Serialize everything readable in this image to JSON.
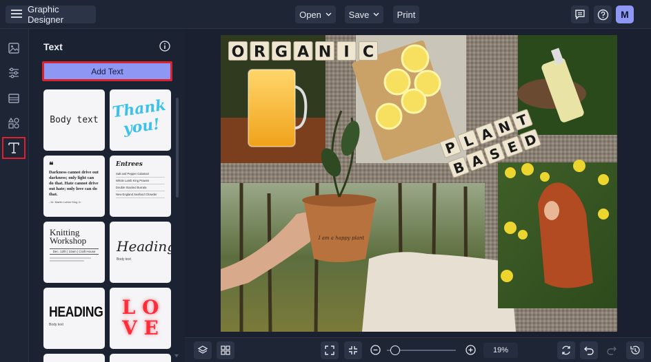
{
  "app": {
    "title": "Graphic Designer"
  },
  "toolbar": {
    "open_label": "Open",
    "save_label": "Save",
    "print_label": "Print",
    "avatar_initial": "M"
  },
  "panel": {
    "title": "Text",
    "add_text_label": "Add Text",
    "templates": {
      "body_text": "Body text",
      "thank_you_1": "Thank",
      "thank_you_2": "you!",
      "quote_text": "Darkness cannot drive out darkness; only light can do that. Hate cannot drive out hate; only love can do that.",
      "quote_author": "- Dr. Martin Luther King Jr.",
      "entrees_title": "Entrees",
      "entrees_items": [
        "Salt and Pepper Calamari",
        "Whole Lamb King Prawns",
        "Double Stacked Burrata",
        "New England Seafood Chowder"
      ],
      "knitting_title_1": "Knitting",
      "knitting_title_2": "Workshop",
      "knitting_details": "Dec. 12th | 10am | Craft House",
      "heading_script": "Heading",
      "heading_script_sub": "Body text",
      "heading_bold": "HEADING",
      "heading_bold_sub": "Body text",
      "love_1": "L O",
      "love_2": "V E"
    }
  },
  "canvas": {
    "organic_tiles": [
      "O",
      "R",
      "G",
      "A",
      "N",
      "I",
      "C"
    ],
    "plant_tiles": [
      "P",
      "L",
      "A",
      "N",
      "T"
    ],
    "based_tiles": [
      "B",
      "A",
      "S",
      "E",
      "D"
    ],
    "pot_text": "I am a happy plant"
  },
  "bottombar": {
    "zoom_value": "19%",
    "zoom_level": 0.06
  },
  "colors": {
    "accent": "#8f97f5",
    "highlight": "#d9232f",
    "background": "#1b2232"
  }
}
